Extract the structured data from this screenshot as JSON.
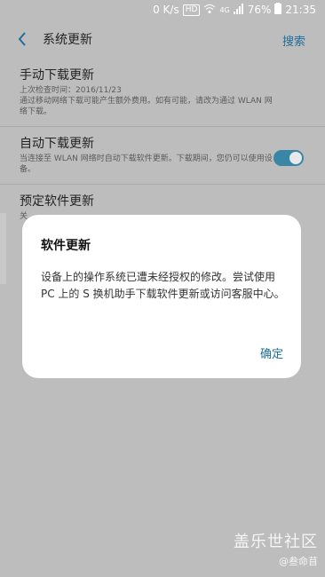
{
  "statusbar": {
    "speed": "0 K/s",
    "hd": "HD",
    "network": "4G",
    "battery": "76%",
    "time": "21:35"
  },
  "appbar": {
    "title": "系统更新",
    "search": "搜索"
  },
  "settings": [
    {
      "title": "手动下载更新",
      "subtitle": "上次检查时间：2016/11/23\n通过移动网络下载可能产生额外费用。如有可能，请改为通过 WLAN 网络下载。"
    },
    {
      "title": "自动下载更新",
      "subtitle": "当连接至 WLAN 网络时自动下载软件更新。下载期间，您仍可以使用设备。",
      "toggle_on": true
    },
    {
      "title": "预定软件更新",
      "subtitle": "关"
    }
  ],
  "dialog": {
    "title": "软件更新",
    "body": "设备上的操作系统已遭未经授权的修改。尝试使用 PC 上的 S 换机助手下载软件更新或访问客服中心。",
    "ok": "确定"
  },
  "watermark": {
    "main": "盖乐世社区",
    "sub": "@叁命苜"
  }
}
